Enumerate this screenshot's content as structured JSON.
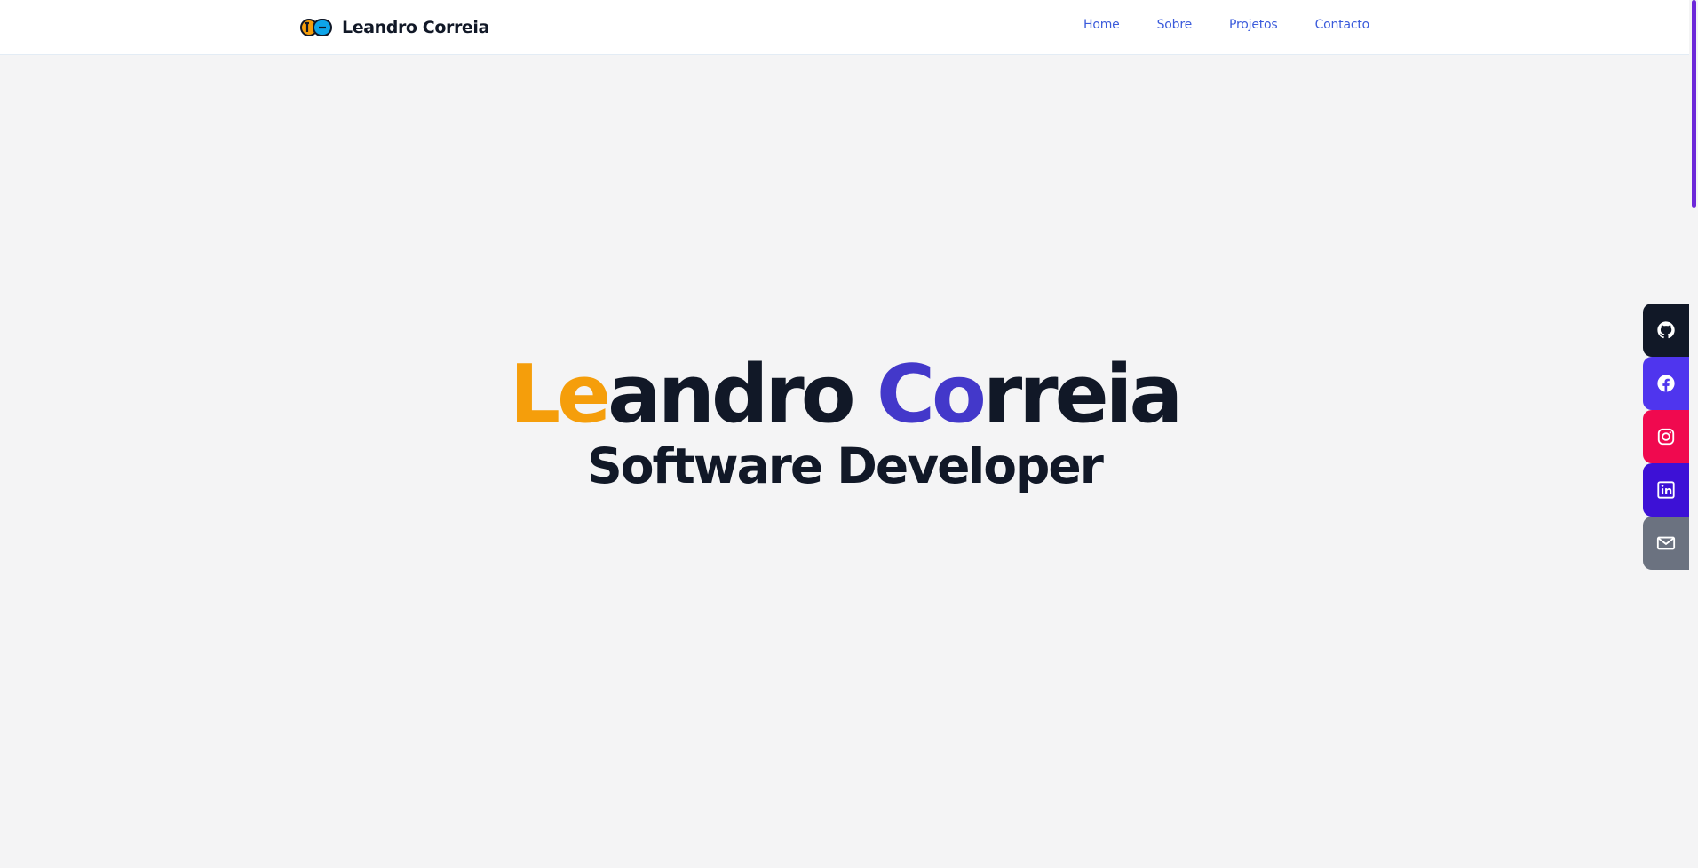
{
  "header": {
    "brand_name": "Leandro Correia",
    "nav": [
      {
        "label": "Home"
      },
      {
        "label": "Sobre"
      },
      {
        "label": "Projetos"
      },
      {
        "label": "Contacto"
      }
    ]
  },
  "hero": {
    "name_parts": {
      "first_accent": "Le",
      "first_rest": "andro ",
      "last_accent": "Co",
      "last_rest": "rreia"
    },
    "role": "Software Developer"
  },
  "social": [
    {
      "icon": "github-icon",
      "color": "#111827"
    },
    {
      "icon": "facebook-icon",
      "color": "#4f35ee"
    },
    {
      "icon": "instagram-icon",
      "color": "#f0094f"
    },
    {
      "icon": "linkedin-icon",
      "color": "#3d11d6"
    },
    {
      "icon": "mail-icon",
      "color": "#6b7280"
    }
  ],
  "colors": {
    "accent_orange": "#f59e0b",
    "accent_blue": "#4338ca",
    "text_dark": "#111827",
    "nav_link": "#3b5bdb",
    "scrollbar": "#6d28d9"
  }
}
